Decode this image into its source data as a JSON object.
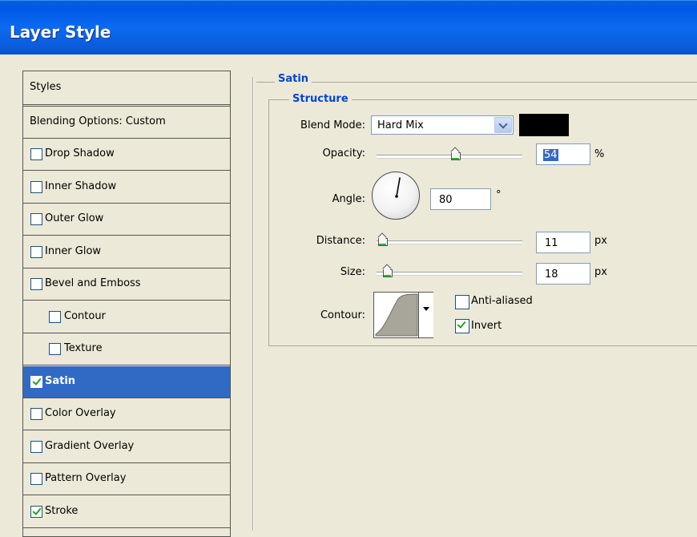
{
  "window": {
    "title": "Layer Style"
  },
  "styles_panel": {
    "header": "Styles",
    "blending_options": "Blending Options: Custom",
    "items": [
      {
        "label": "Drop Shadow",
        "checked": false,
        "level": 1,
        "selected": false
      },
      {
        "label": "Inner Shadow",
        "checked": false,
        "level": 1,
        "selected": false
      },
      {
        "label": "Outer Glow",
        "checked": false,
        "level": 1,
        "selected": false
      },
      {
        "label": "Inner Glow",
        "checked": false,
        "level": 1,
        "selected": false
      },
      {
        "label": "Bevel and Emboss",
        "checked": false,
        "level": 1,
        "selected": false
      },
      {
        "label": "Contour",
        "checked": false,
        "level": 2,
        "selected": false
      },
      {
        "label": "Texture",
        "checked": false,
        "level": 2,
        "selected": false
      },
      {
        "label": "Satin",
        "checked": true,
        "level": 1,
        "selected": true
      },
      {
        "label": "Color Overlay",
        "checked": false,
        "level": 1,
        "selected": false
      },
      {
        "label": "Gradient Overlay",
        "checked": false,
        "level": 1,
        "selected": false
      },
      {
        "label": "Pattern Overlay",
        "checked": false,
        "level": 1,
        "selected": false
      },
      {
        "label": "Stroke",
        "checked": true,
        "level": 1,
        "selected": false
      }
    ]
  },
  "satin": {
    "group_title": "Satin",
    "structure_title": "Structure",
    "blend_mode": {
      "label": "Blend Mode:",
      "value": "Hard Mix",
      "color": "#000000"
    },
    "opacity": {
      "label": "Opacity:",
      "value": "54",
      "unit": "%",
      "fraction": 0.54
    },
    "angle": {
      "label": "Angle:",
      "value": "80",
      "unit": "°",
      "degrees": 80
    },
    "distance": {
      "label": "Distance:",
      "value": "11",
      "unit": "px",
      "fraction": 0.04
    },
    "size": {
      "label": "Size:",
      "value": "18",
      "unit": "px",
      "fraction": 0.07
    },
    "contour": {
      "label": "Contour:"
    },
    "anti_aliased": {
      "label": "Anti-aliased",
      "checked": false
    },
    "invert": {
      "label": "Invert",
      "checked": true
    }
  },
  "colors": {
    "title_bar": "#0a5fd8",
    "selection": "#316ac5",
    "group_label": "#0046d5",
    "background": "#ece9d8"
  }
}
